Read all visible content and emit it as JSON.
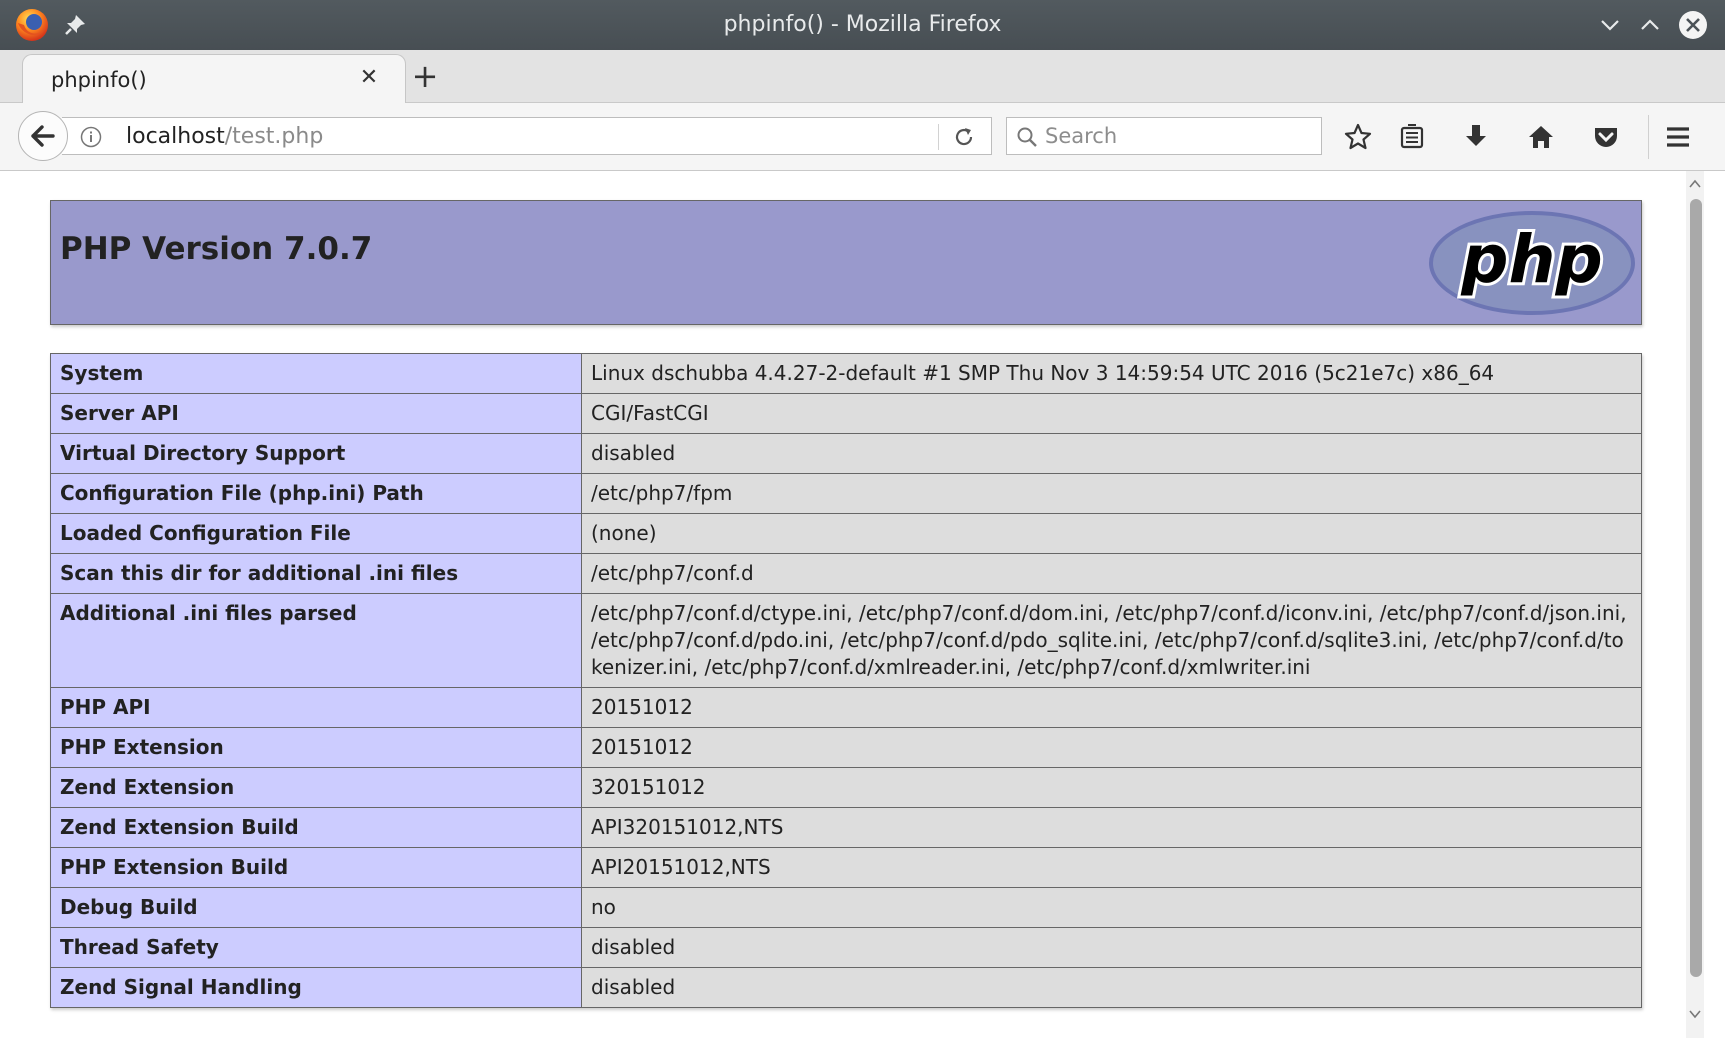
{
  "window": {
    "title": "phpinfo() - Mozilla Firefox"
  },
  "tabs": [
    {
      "label": "phpinfo()"
    }
  ],
  "navbar": {
    "url_host": "localhost",
    "url_path": "/test.php",
    "search_placeholder": "Search"
  },
  "page": {
    "version_title": "PHP Version 7.0.7",
    "logo_text": "php",
    "rows": [
      {
        "key": "System",
        "value": "Linux dschubba 4.4.27-2-default #1 SMP Thu Nov 3 14:59:54 UTC 2016 (5c21e7c) x86_64"
      },
      {
        "key": "Server API",
        "value": "CGI/FastCGI"
      },
      {
        "key": "Virtual Directory Support",
        "value": "disabled"
      },
      {
        "key": "Configuration File (php.ini) Path",
        "value": "/etc/php7/fpm"
      },
      {
        "key": "Loaded Configuration File",
        "value": "(none)"
      },
      {
        "key": "Scan this dir for additional .ini files",
        "value": "/etc/php7/conf.d"
      },
      {
        "key": "Additional .ini files parsed",
        "value": "/etc/php7/conf.d/ctype.ini, /etc/php7/conf.d/dom.ini, /etc/php7/conf.d/iconv.ini, /etc/php7/conf.d/json.ini, /etc/php7/conf.d/pdo.ini, /etc/php7/conf.d/pdo_sqlite.ini, /etc/php7/conf.d/sqlite3.ini, /etc/php7/conf.d/tokenizer.ini, /etc/php7/conf.d/xmlreader.ini, /etc/php7/conf.d/xmlwriter.ini"
      },
      {
        "key": "PHP API",
        "value": "20151012"
      },
      {
        "key": "PHP Extension",
        "value": "20151012"
      },
      {
        "key": "Zend Extension",
        "value": "320151012"
      },
      {
        "key": "Zend Extension Build",
        "value": "API320151012,NTS"
      },
      {
        "key": "PHP Extension Build",
        "value": "API20151012,NTS"
      },
      {
        "key": "Debug Build",
        "value": "no"
      },
      {
        "key": "Thread Safety",
        "value": "disabled"
      },
      {
        "key": "Zend Signal Handling",
        "value": "disabled"
      }
    ]
  },
  "colors": {
    "header_bg": "#9999cc",
    "key_bg": "#ccccff",
    "value_bg": "#dddddd",
    "titlebar_bg": "#4b5257"
  },
  "icons": [
    "firefox-icon",
    "pin-icon",
    "minimize-icon",
    "maximize-icon",
    "close-icon",
    "back-icon",
    "info-icon",
    "reload-icon",
    "search-icon",
    "bookmark-star-icon",
    "reading-list-icon",
    "downloads-icon",
    "home-icon",
    "pocket-icon",
    "menu-icon"
  ]
}
